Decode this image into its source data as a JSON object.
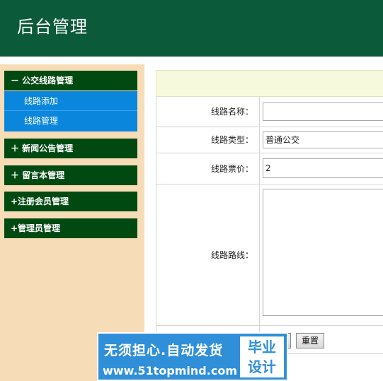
{
  "header": {
    "title": "后台管理"
  },
  "sidebar": {
    "menus": [
      {
        "label": "－ 公交线路管理"
      },
      {
        "label": "＋ 新闻公告管理"
      },
      {
        "label": "＋ 留言本管理"
      },
      {
        "label": "+注册会员管理"
      },
      {
        "label": "+管理员管理"
      }
    ],
    "submenu": [
      {
        "label": "线路添加"
      },
      {
        "label": "线路管理"
      }
    ]
  },
  "form": {
    "name_label": "线路名称：",
    "name_value": "",
    "type_label": "线路类型：",
    "type_value": "普通公交",
    "price_label": "线路票价：",
    "price_value": "2",
    "route_label": "线路路线：",
    "route_value": "",
    "reset_label": "重置"
  },
  "watermark": {
    "line1": "无须担心.自动发货",
    "line2": "www.51topmind.com",
    "box_line1": "毕业",
    "box_line2": "设计"
  }
}
